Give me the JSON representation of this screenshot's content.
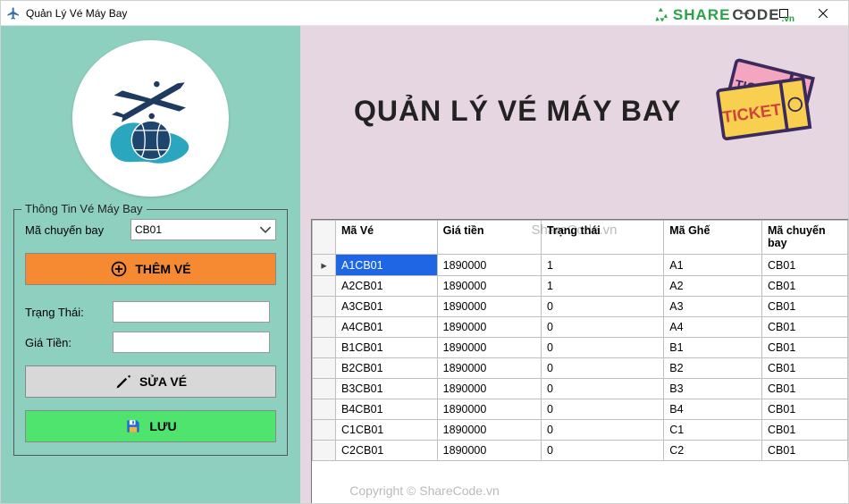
{
  "window": {
    "title": "Quản Lý Vé Máy Bay"
  },
  "main": {
    "title": "QUẢN LÝ VÉ MÁY BAY"
  },
  "sidebar": {
    "fieldset_title": "Thông Tin Vé Máy Bay",
    "flight_label": "Mã chuyến bay",
    "flight_value": "CB01",
    "btn_add": "THÊM VÉ",
    "status_label": "Trạng Thái:",
    "price_label": "Giá Tiền:",
    "btn_edit": "SỬA VÉ",
    "btn_save": "LƯU"
  },
  "table": {
    "headers": {
      "mave": "Mã Vé",
      "giatien": "Giá tiền",
      "trangthai": "Trạng thái",
      "maghe": "Mã Ghế",
      "machuyenbay": "Mã chuyến bay"
    },
    "rows": [
      {
        "sel": true,
        "mave": "A1CB01",
        "giatien": "1890000",
        "trangthai": "1",
        "maghe": "A1",
        "macb": "CB01"
      },
      {
        "sel": false,
        "mave": "A2CB01",
        "giatien": "1890000",
        "trangthai": "1",
        "maghe": "A2",
        "macb": "CB01"
      },
      {
        "sel": false,
        "mave": "A3CB01",
        "giatien": "1890000",
        "trangthai": "0",
        "maghe": "A3",
        "macb": "CB01"
      },
      {
        "sel": false,
        "mave": "A4CB01",
        "giatien": "1890000",
        "trangthai": "0",
        "maghe": "A4",
        "macb": "CB01"
      },
      {
        "sel": false,
        "mave": "B1CB01",
        "giatien": "1890000",
        "trangthai": "0",
        "maghe": "B1",
        "macb": "CB01"
      },
      {
        "sel": false,
        "mave": "B2CB01",
        "giatien": "1890000",
        "trangthai": "0",
        "maghe": "B2",
        "macb": "CB01"
      },
      {
        "sel": false,
        "mave": "B3CB01",
        "giatien": "1890000",
        "trangthai": "0",
        "maghe": "B3",
        "macb": "CB01"
      },
      {
        "sel": false,
        "mave": "B4CB01",
        "giatien": "1890000",
        "trangthai": "0",
        "maghe": "B4",
        "macb": "CB01"
      },
      {
        "sel": false,
        "mave": "C1CB01",
        "giatien": "1890000",
        "trangthai": "0",
        "maghe": "C1",
        "macb": "CB01"
      },
      {
        "sel": false,
        "mave": "C2CB01",
        "giatien": "1890000",
        "trangthai": "0",
        "maghe": "C2",
        "macb": "CB01"
      }
    ]
  },
  "watermarks": {
    "center": "ShareCode.vn",
    "bottom": "Copyright © ShareCode.vn",
    "logo_text_1": "SHARE",
    "logo_text_2": "CODE",
    "logo_text_3": ".vn"
  }
}
